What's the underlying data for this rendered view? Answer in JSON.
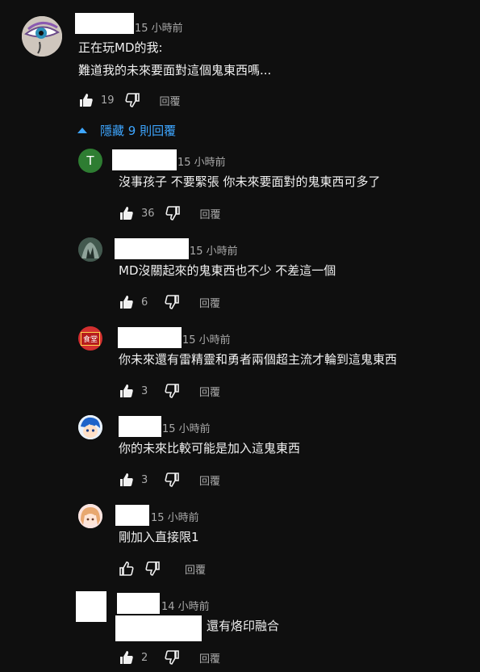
{
  "top_comment": {
    "time": "15 小時前",
    "line1": "正在玩MD的我:",
    "line2": "難道我的未來要面對這個鬼東西嗎...",
    "likes": "19",
    "reply_label": "回覆"
  },
  "replies_toggle": {
    "label": "隱藏 9 則回覆"
  },
  "replies": [
    {
      "time": "15 小時前",
      "text": "沒事孩子 不要緊張  你未來要面對的鬼東西可多了",
      "likes": "36",
      "reply_label": "回覆",
      "avatar_letter": "T"
    },
    {
      "time": "15 小時前",
      "text": "MD沒關起來的鬼東西也不少 不差這一個",
      "likes": "6",
      "reply_label": "回覆"
    },
    {
      "time": "15 小時前",
      "text": "你未來還有雷精靈和勇者兩個超主流才輪到這鬼東西",
      "likes": "3",
      "reply_label": "回覆",
      "avatar_text": "食堂"
    },
    {
      "time": "15 小時前",
      "text": "你的未來比較可能是加入這鬼東西",
      "likes": "3",
      "reply_label": "回覆"
    },
    {
      "time": "15 小時前",
      "text": "剛加入直接限1",
      "likes": "",
      "reply_label": "回覆"
    },
    {
      "time": "14 小時前",
      "text": "還有烙印融合",
      "likes": "2",
      "reply_label": "回覆"
    }
  ]
}
